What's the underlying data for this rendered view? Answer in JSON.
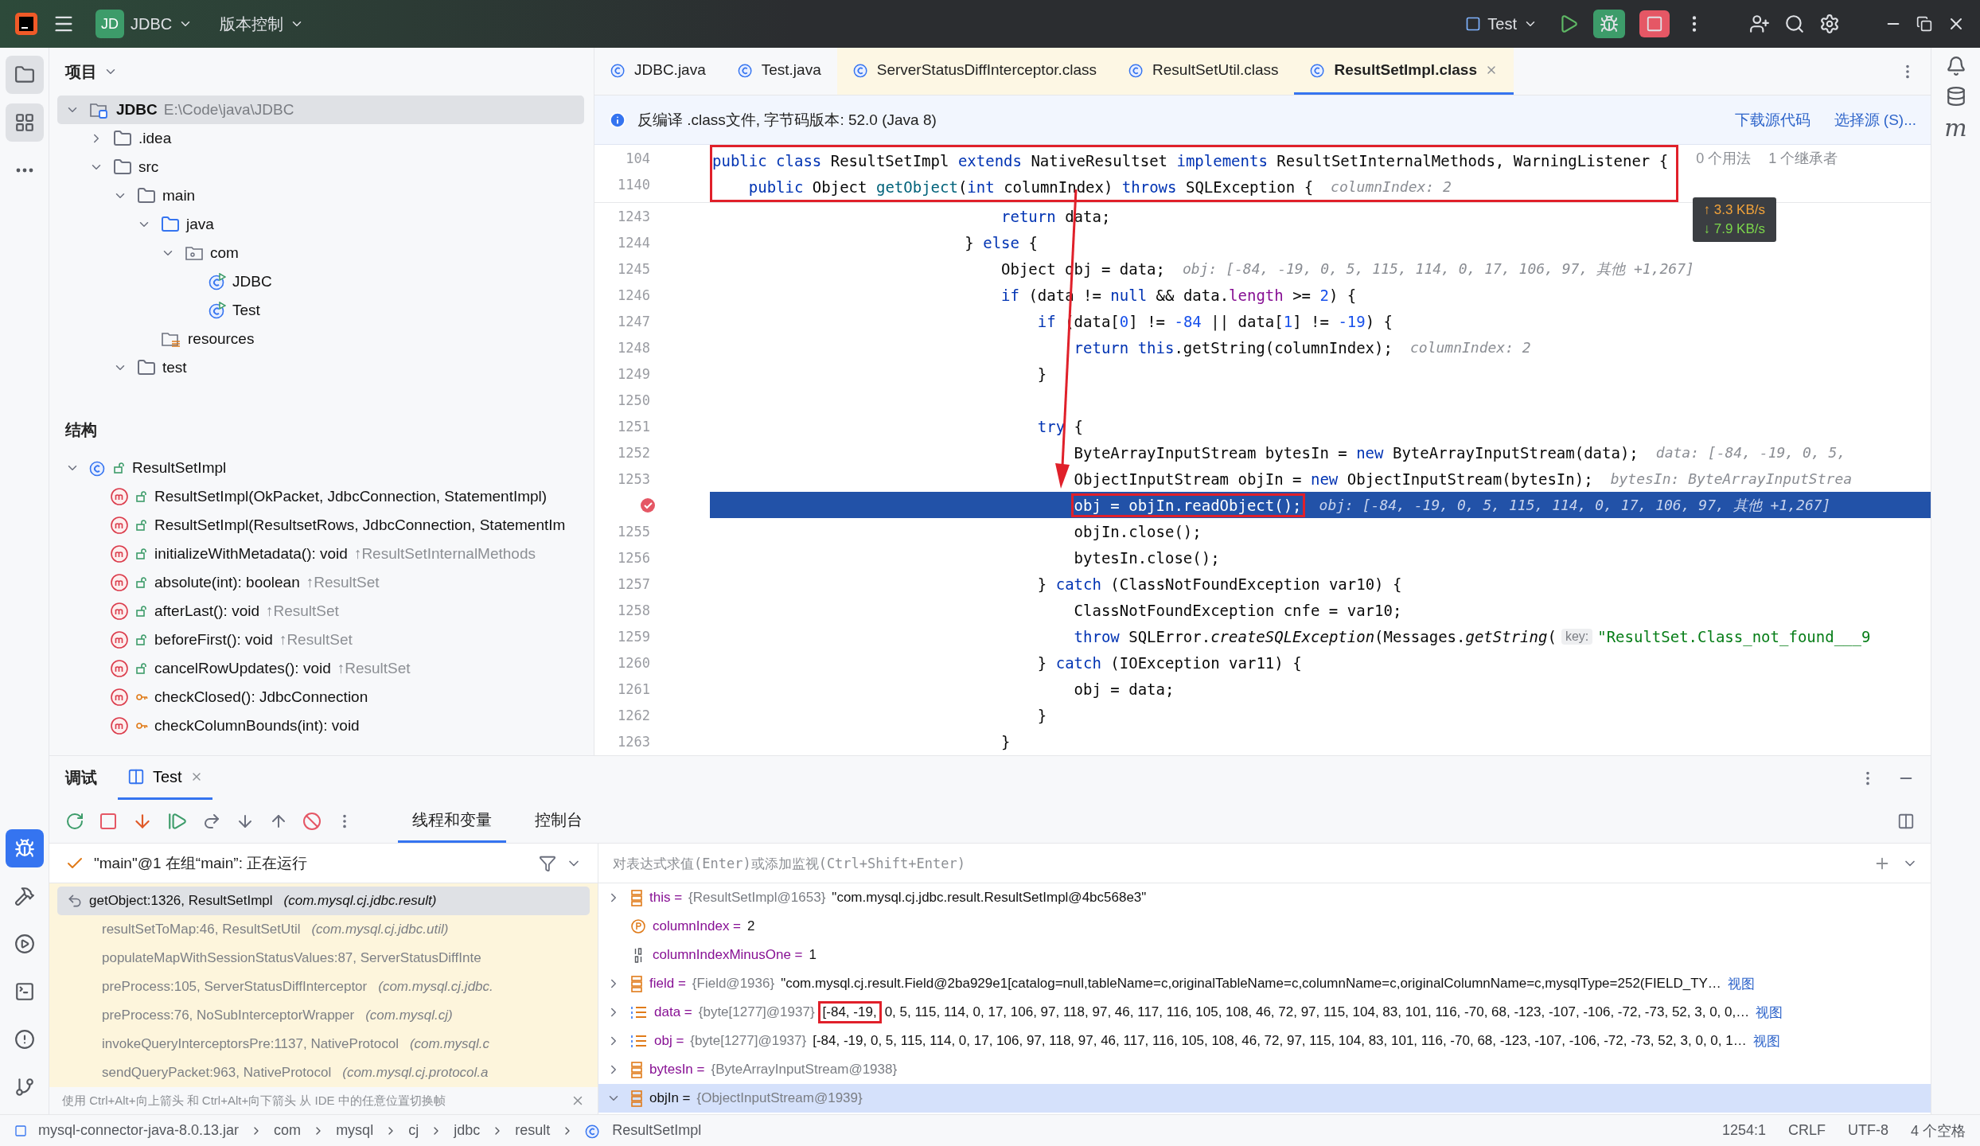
{
  "title_bar": {
    "project_badge": "JD",
    "project": "JDBC",
    "vcs": "版本控制",
    "run_config": "Test"
  },
  "left_strip_top": [
    {
      "kind": "project",
      "selected": true
    },
    {
      "kind": "structure",
      "selected": true
    },
    {
      "kind": "more",
      "selected": false
    }
  ],
  "left_strip_bottom": [
    {
      "kind": "debug",
      "selected": true
    },
    {
      "kind": "build",
      "selected": false
    },
    {
      "kind": "run",
      "selected": false
    },
    {
      "kind": "terminal",
      "selected": false
    },
    {
      "kind": "problems",
      "selected": false
    },
    {
      "kind": "git",
      "selected": false
    }
  ],
  "right_strip": {
    "plugin_label": "m"
  },
  "project_panel": {
    "title": "项目",
    "tree": [
      {
        "label": "JDBC",
        "path": "E:\\Code\\java\\JDBC",
        "kind": "module",
        "expanded": true,
        "selected": true,
        "children": [
          {
            "label": ".idea",
            "kind": "folder",
            "expanded": false,
            "selected": false
          },
          {
            "label": "src",
            "kind": "folder",
            "expanded": true,
            "selected": false,
            "children": [
              {
                "label": "main",
                "kind": "folder",
                "expanded": true,
                "selected": false,
                "children": [
                  {
                    "label": "java",
                    "kind": "source",
                    "expanded": true,
                    "selected": false,
                    "children": [
                      {
                        "label": "com",
                        "kind": "package",
                        "expanded": true,
                        "selected": false,
                        "children": [
                          {
                            "label": "JDBC",
                            "kind": "class",
                            "selected": false
                          },
                          {
                            "label": "Test",
                            "kind": "class",
                            "selected": false
                          }
                        ]
                      }
                    ]
                  },
                  {
                    "label": "resources",
                    "kind": "resources",
                    "selected": false
                  }
                ]
              },
              {
                "label": "test",
                "kind": "folder",
                "expanded": true,
                "selected": false
              }
            ]
          }
        ]
      }
    ]
  },
  "structure_panel": {
    "title": "结构",
    "tree": [
      {
        "label": "ResultSetImpl",
        "kind": "class",
        "expanded": true,
        "children": [
          {
            "label": "ResultSetImpl(OkPacket, JdbcConnection, StatementImpl)",
            "kind": "public-method"
          },
          {
            "label": "ResultSetImpl(ResultsetRows, JdbcConnection, StatementIm",
            "kind": "public-method"
          },
          {
            "label": "initializeWithMetadata(): void",
            "inherited": "↑ResultSetInternalMethods",
            "kind": "public-method"
          },
          {
            "label": "absolute(int): boolean",
            "inherited": "↑ResultSet",
            "kind": "public-method"
          },
          {
            "label": "afterLast(): void",
            "inherited": "↑ResultSet",
            "kind": "public-method"
          },
          {
            "label": "beforeFirst(): void",
            "inherited": "↑ResultSet",
            "kind": "public-method"
          },
          {
            "label": "cancelRowUpdates(): void",
            "inherited": "↑ResultSet",
            "kind": "public-method"
          },
          {
            "label": "checkClosed(): JdbcConnection",
            "kind": "private-method"
          },
          {
            "label": "checkColumnBounds(int): void",
            "kind": "private-method"
          }
        ]
      }
    ]
  },
  "editor": {
    "tabs": [
      {
        "label": "JDBC.java",
        "kind": "java",
        "selected": false
      },
      {
        "label": "Test.java",
        "kind": "java",
        "selected": false
      },
      {
        "label": "ServerStatusDiffInterceptor.class",
        "kind": "class",
        "selected": false
      },
      {
        "label": "ResultSetUtil.class",
        "kind": "class",
        "selected": false
      },
      {
        "label": "ResultSetImpl.class",
        "kind": "class",
        "selected": true
      }
    ],
    "banner": {
      "text": "反编译 .class文件, 字节码版本: 52.0 (Java 8)",
      "links": [
        "下载源代码",
        "选择源 (S)..."
      ]
    },
    "sticky": {
      "annotated": true,
      "lines": [
        {
          "number": "104",
          "tokens": [
            {
              "text": "public class",
              "kind": "kw"
            },
            {
              "text": " ResultSetImpl ",
              "kind": "plain"
            },
            {
              "text": "extends",
              "kind": "kw"
            },
            {
              "text": " NativeResultset ",
              "kind": "plain"
            },
            {
              "text": "implements",
              "kind": "kw"
            },
            {
              "text": " ResultSetInternalMethods, WarningListener {",
              "kind": "plain"
            },
            {
              "text": "0 个用法",
              "kind": "usage"
            },
            {
              "text": "1 个继承者",
              "kind": "usage"
            }
          ]
        },
        {
          "number": "1140",
          "tokens": [
            {
              "text": "    public",
              "kind": "kw"
            },
            {
              "text": " Object ",
              "kind": "plain"
            },
            {
              "text": "getObject",
              "kind": "fn"
            },
            {
              "text": "(",
              "kind": "plain"
            },
            {
              "text": "int",
              "kind": "kw"
            },
            {
              "text": " columnIndex) ",
              "kind": "plain"
            },
            {
              "text": "throws",
              "kind": "kw"
            },
            {
              "text": " SQLException {",
              "kind": "plain"
            },
            {
              "text": "columnIndex: 2",
              "kind": "hint"
            }
          ]
        }
      ]
    },
    "lines": [
      {
        "number": "1243",
        "current": false,
        "breakpoint": false,
        "tokens": [
          {
            "text": "                                return",
            "kind": "kw"
          },
          {
            "text": " data;",
            "kind": "plain"
          }
        ]
      },
      {
        "number": "1244",
        "current": false,
        "breakpoint": false,
        "tokens": [
          {
            "text": "                            } ",
            "kind": "plain"
          },
          {
            "text": "else",
            "kind": "kw"
          },
          {
            "text": " {",
            "kind": "plain"
          }
        ]
      },
      {
        "number": "1245",
        "current": false,
        "breakpoint": false,
        "tokens": [
          {
            "text": "                                Object obj = data;",
            "kind": "plain"
          },
          {
            "text": "obj: [-84, -19, 0, 5, 115, 114, 0, 17, 106, 97, 其他 +1,267]",
            "kind": "hint"
          }
        ]
      },
      {
        "number": "1246",
        "current": false,
        "breakpoint": false,
        "tokens": [
          {
            "text": "                                if",
            "kind": "kw"
          },
          {
            "text": " (data != ",
            "kind": "plain"
          },
          {
            "text": "null",
            "kind": "kw"
          },
          {
            "text": " && data.",
            "kind": "plain"
          },
          {
            "text": "length",
            "kind": "field"
          },
          {
            "text": " >= ",
            "kind": "plain"
          },
          {
            "text": "2",
            "kind": "num"
          },
          {
            "text": ") {",
            "kind": "plain"
          }
        ]
      },
      {
        "number": "1247",
        "current": false,
        "breakpoint": false,
        "tokens": [
          {
            "text": "                                    if",
            "kind": "kw"
          },
          {
            "text": " (data[",
            "kind": "plain"
          },
          {
            "text": "0",
            "kind": "num"
          },
          {
            "text": "] != ",
            "kind": "plain"
          },
          {
            "text": "-84",
            "kind": "num"
          },
          {
            "text": " || data[",
            "kind": "plain"
          },
          {
            "text": "1",
            "kind": "num"
          },
          {
            "text": "] != ",
            "kind": "plain"
          },
          {
            "text": "-19",
            "kind": "num"
          },
          {
            "text": ") {",
            "kind": "plain"
          }
        ]
      },
      {
        "number": "1248",
        "current": false,
        "breakpoint": false,
        "tokens": [
          {
            "text": "                                        return this",
            "kind": "kw"
          },
          {
            "text": ".getString(columnIndex);",
            "kind": "plain"
          },
          {
            "text": "columnIndex: 2",
            "kind": "hint"
          }
        ]
      },
      {
        "number": "1249",
        "current": false,
        "breakpoint": false,
        "tokens": [
          {
            "text": "                                    }",
            "kind": "plain"
          }
        ]
      },
      {
        "number": "1250",
        "current": false,
        "breakpoint": false
      },
      {
        "number": "1251",
        "current": false,
        "breakpoint": false,
        "tokens": [
          {
            "text": "                                    try",
            "kind": "kw"
          },
          {
            "text": " {",
            "kind": "plain"
          }
        ]
      },
      {
        "number": "1252",
        "current": false,
        "breakpoint": false,
        "tokens": [
          {
            "text": "                                        ByteArrayInputStream bytesIn = ",
            "kind": "plain"
          },
          {
            "text": "new",
            "kind": "kw"
          },
          {
            "text": " ByteArrayInputStream(data);",
            "kind": "plain"
          },
          {
            "text": "data: [-84, -19, 0, 5,",
            "kind": "hint"
          }
        ]
      },
      {
        "number": "1253",
        "current": false,
        "breakpoint": false,
        "tokens": [
          {
            "text": "                                        ObjectInputStream objIn = ",
            "kind": "plain"
          },
          {
            "text": "new",
            "kind": "kw"
          },
          {
            "text": " ObjectInputStream(bytesIn);",
            "kind": "plain"
          },
          {
            "text": "bytesIn: ByteArrayInputStrea",
            "kind": "hint"
          }
        ]
      },
      {
        "current": true,
        "breakpoint": true,
        "tokens": [
          {
            "text": "                                        obj = objIn.readObject();",
            "kind": "boxed"
          },
          {
            "text": "obj: [-84, -19, 0, 5, 115, 114, 0, 17, 106, 97, 其他 +1,267]",
            "kind": "hint"
          }
        ]
      },
      {
        "number": "1255",
        "current": false,
        "breakpoint": false,
        "tokens": [
          {
            "text": "                                        objIn.close();",
            "kind": "plain"
          }
        ]
      },
      {
        "number": "1256",
        "current": false,
        "breakpoint": false,
        "tokens": [
          {
            "text": "                                        bytesIn.close();",
            "kind": "plain"
          }
        ]
      },
      {
        "number": "1257",
        "current": false,
        "breakpoint": false,
        "tokens": [
          {
            "text": "                                    } ",
            "kind": "plain"
          },
          {
            "text": "catch",
            "kind": "kw"
          },
          {
            "text": " (ClassNotFoundException var10) {",
            "kind": "plain"
          }
        ]
      },
      {
        "number": "1258",
        "current": false,
        "breakpoint": false,
        "tokens": [
          {
            "text": "                                        ClassNotFoundException cnfe = var10;",
            "kind": "plain"
          }
        ]
      },
      {
        "number": "1259",
        "current": false,
        "breakpoint": false,
        "tokens": [
          {
            "text": "                                        throw",
            "kind": "kw"
          },
          {
            "text": " SQLError.",
            "kind": "plain"
          },
          {
            "text": "createSQLException",
            "kind": "italic"
          },
          {
            "text": "(Messages.",
            "kind": "plain"
          },
          {
            "text": "getString",
            "kind": "italic"
          },
          {
            "text": "(",
            "kind": "plain"
          },
          {
            "text": "key:",
            "kind": "param"
          },
          {
            "text": "\"ResultSet.Class_not_found___9",
            "kind": "str"
          }
        ]
      },
      {
        "number": "1260",
        "current": false,
        "breakpoint": false,
        "tokens": [
          {
            "text": "                                    } ",
            "kind": "plain"
          },
          {
            "text": "catch",
            "kind": "kw"
          },
          {
            "text": " (IOException var11) {",
            "kind": "plain"
          }
        ]
      },
      {
        "number": "1261",
        "current": false,
        "breakpoint": false,
        "tokens": [
          {
            "text": "                                        obj = data;",
            "kind": "plain"
          }
        ]
      },
      {
        "number": "1262",
        "current": false,
        "breakpoint": false,
        "tokens": [
          {
            "text": "                                    }",
            "kind": "plain"
          }
        ]
      },
      {
        "number": "1263",
        "current": false,
        "breakpoint": false,
        "tokens": [
          {
            "text": "                                }",
            "kind": "plain"
          }
        ]
      }
    ],
    "speed": {
      "up": "↑ 3.3 KB/s",
      "down": "↓ 7.9 KB/s"
    }
  },
  "debug": {
    "title": "调试",
    "run_tab": {
      "label": "Test",
      "selected": true
    },
    "view_tabs": [
      {
        "label": "线程和变量",
        "selected": true
      },
      {
        "label": "控制台",
        "selected": false
      }
    ],
    "thread": "\"main\"@1 在组“main”: 正在运行",
    "frames": [
      {
        "method": "getObject:1326, ResultSetImpl",
        "package": "(com.mysql.cj.jdbc.result)",
        "selected": true
      },
      {
        "method": "resultSetToMap:46, ResultSetUtil",
        "package": "(com.mysql.cj.jdbc.util)",
        "selected": false
      },
      {
        "method": "populateMapWithSessionStatusValues:87, ServerStatusDiffInte",
        "selected": false
      },
      {
        "method": "preProcess:105, ServerStatusDiffInterceptor",
        "package": "(com.mysql.cj.jdbc.",
        "selected": false
      },
      {
        "method": "preProcess:76, NoSubInterceptorWrapper",
        "package": "(com.mysql.cj)",
        "selected": false
      },
      {
        "method": "invokeQueryInterceptorsPre:1137, NativeProtocol",
        "package": "(com.mysql.c",
        "selected": false
      },
      {
        "method": "sendQueryPacket:963, NativeProtocol",
        "package": "(com.mysql.cj.protocol.a",
        "selected": false
      }
    ],
    "hint": "使用 Ctrl+Alt+向上箭头 和 Ctrl+Alt+向下箭头 从 IDE 中的任意位置切换帧",
    "expression_placeholder": "对表达式求值(Enter)或添加监视(Ctrl+Shift+Enter)",
    "variables": [
      {
        "name": "this =",
        "type": "{ResultSetImpl@1653}",
        "value": "\"com.mysql.cj.jdbc.result.ResultSetImpl@4bc568e3\"",
        "kind": "object",
        "expandable": true,
        "expanded": false,
        "selected": false
      },
      {
        "name": "columnIndex =",
        "value": "2",
        "kind": "param",
        "expandable": false,
        "selected": false
      },
      {
        "name": "columnIndexMinusOne =",
        "value": "1",
        "kind": "primitive",
        "expandable": false,
        "selected": false
      },
      {
        "name": "field =",
        "type": "{Field@1936}",
        "value": "\"com.mysql.cj.result.Field@2ba929e1[catalog=null,tableName=c,originalTableName=c,columnName=c,originalColumnName=c,mysqlType=252(FIELD_TY…",
        "link": "视图",
        "kind": "object",
        "expandable": true,
        "expanded": false,
        "selected": false
      },
      {
        "name": "data =",
        "type": "{byte[1277]@1937}",
        "value_boxed": "[-84, -19,",
        "value": "0, 5, 115, 114, 0, 17, 106, 97, 118, 97, 46, 117, 116, 105, 108, 46, 72, 97, 115, 104, 83, 101, 116, -70, 68, -123, -107, -106, -72, -73, 52, 3, 0, 0,…",
        "link": "视图",
        "kind": "array",
        "expandable": true,
        "expanded": false,
        "selected": false
      },
      {
        "name": "obj =",
        "type": "{byte[1277]@1937}",
        "value": "[-84, -19, 0, 5, 115, 114, 0, 17, 106, 97, 118, 97, 46, 117, 116, 105, 108, 46, 72, 97, 115, 104, 83, 101, 116, -70, 68, -123, -107, -106, -72, -73, 52, 3, 0, 0, 1…",
        "link": "视图",
        "kind": "array",
        "expandable": true,
        "expanded": false,
        "selected": false
      },
      {
        "name": "bytesIn =",
        "type": "{ByteArrayInputStream@1938}",
        "kind": "object",
        "expandable": true,
        "expanded": false,
        "selected": false
      },
      {
        "name": "objIn =",
        "type": "{ObjectInputStream@1939}",
        "kind": "object",
        "expandable": true,
        "expanded": true,
        "selected": true
      }
    ]
  },
  "status_bar": {
    "breadcrumbs": [
      {
        "label": "mysql-connector-java-8.0.13.jar",
        "kind": "jar"
      },
      {
        "label": "com",
        "kind": "package"
      },
      {
        "label": "mysql",
        "kind": "package"
      },
      {
        "label": "cj",
        "kind": "package"
      },
      {
        "label": "jdbc",
        "kind": "package"
      },
      {
        "label": "result",
        "kind": "package"
      },
      {
        "label": "ResultSetImpl",
        "kind": "class"
      }
    ],
    "items": [
      "1254:1",
      "CRLF",
      "UTF-8",
      "4 个空格"
    ]
  }
}
